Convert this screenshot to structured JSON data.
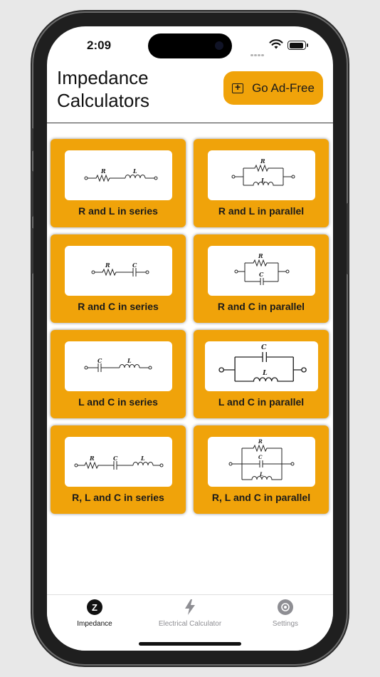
{
  "status": {
    "time": "2:09"
  },
  "header": {
    "title_line1": "Impedance",
    "title_line2": "Calculators",
    "ad_free_label": "Go Ad-Free"
  },
  "calculators": [
    {
      "label": "R and L in series"
    },
    {
      "label": "R and L in parallel"
    },
    {
      "label": "R and C in series"
    },
    {
      "label": "R and C in parallel"
    },
    {
      "label": "L and C in series"
    },
    {
      "label": "L and C in parallel"
    },
    {
      "label": "R, L and C in series"
    },
    {
      "label": "R, L and C in parallel"
    }
  ],
  "tabs": [
    {
      "label": "Impedance",
      "icon": "z-circle-icon",
      "active": true
    },
    {
      "label": "Electrical Calculator",
      "icon": "bolt-icon",
      "active": false
    },
    {
      "label": "Settings",
      "icon": "gear-icon",
      "active": false
    }
  ],
  "colors": {
    "accent": "#f0a30a",
    "tab_inactive": "#8e8e93"
  }
}
